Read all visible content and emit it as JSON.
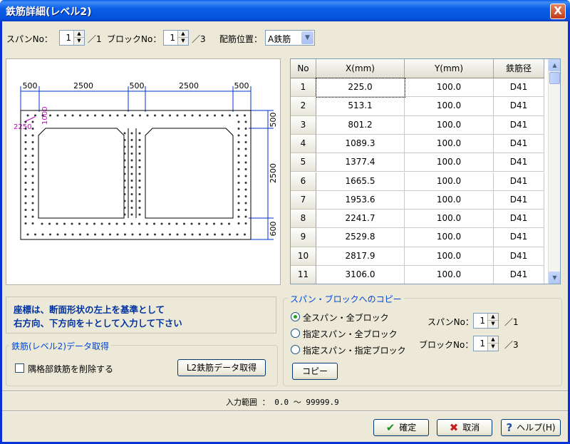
{
  "window": {
    "title": "鉄筋詳細(レベル2)",
    "close_label": "X"
  },
  "top": {
    "span_label": "スパンNo：",
    "span_value": "1",
    "span_total": "／1",
    "block_label": "ブロックNo：",
    "block_value": "1",
    "block_total": "／3",
    "position_label": "配筋位置：",
    "position_value": "A鉄筋"
  },
  "drawing": {
    "top_dims": [
      "500",
      "2500",
      "500",
      "2500",
      "500"
    ],
    "right_dims": [
      "500",
      "2500",
      "600"
    ],
    "annotations": [
      "1000",
      "2250"
    ]
  },
  "grid": {
    "headers": [
      "No",
      "X(mm)",
      "Y(mm)",
      "鉄筋径"
    ],
    "rows": [
      {
        "no": "1",
        "x": "225.0",
        "y": "100.0",
        "d": "D41"
      },
      {
        "no": "2",
        "x": "513.1",
        "y": "100.0",
        "d": "D41"
      },
      {
        "no": "3",
        "x": "801.2",
        "y": "100.0",
        "d": "D41"
      },
      {
        "no": "4",
        "x": "1089.3",
        "y": "100.0",
        "d": "D41"
      },
      {
        "no": "5",
        "x": "1377.4",
        "y": "100.0",
        "d": "D41"
      },
      {
        "no": "6",
        "x": "1665.5",
        "y": "100.0",
        "d": "D41"
      },
      {
        "no": "7",
        "x": "1953.6",
        "y": "100.0",
        "d": "D41"
      },
      {
        "no": "8",
        "x": "2241.7",
        "y": "100.0",
        "d": "D41"
      },
      {
        "no": "9",
        "x": "2529.8",
        "y": "100.0",
        "d": "D41"
      },
      {
        "no": "10",
        "x": "2817.9",
        "y": "100.0",
        "d": "D41"
      },
      {
        "no": "11",
        "x": "3106.0",
        "y": "100.0",
        "d": "D41"
      }
    ]
  },
  "note": {
    "line1": "座標は、断面形状の左上を基準として",
    "line2": "右方向、下方向を＋として入力して下さい"
  },
  "fetch": {
    "title": "鉄筋(レベル2)データ取得",
    "checkbox_label": "隅格部鉄筋を削除する",
    "button_label": "L2鉄筋データ取得"
  },
  "copy": {
    "title": "スパン・ブロックへのコピー",
    "options": [
      "全スパン・全ブロック",
      "指定スパン・全ブロック",
      "指定スパン・指定ブロック"
    ],
    "span_label": "スパンNo：",
    "span_value": "1",
    "span_total": "／1",
    "block_label": "ブロックNo：",
    "block_value": "1",
    "block_total": "／3",
    "button_label": "コピー"
  },
  "status": {
    "range_text": "入力範囲 ： 0.0 〜 99999.9"
  },
  "buttons": {
    "ok": "確定",
    "cancel": "取消",
    "help": "ヘルプ(H)"
  },
  "colors": {
    "title_bar": "#0a5ee8",
    "note_text": "#0033a0",
    "legend_text": "#0046d5",
    "annotation": "#cc00cc",
    "dimension": "#0033cc"
  }
}
